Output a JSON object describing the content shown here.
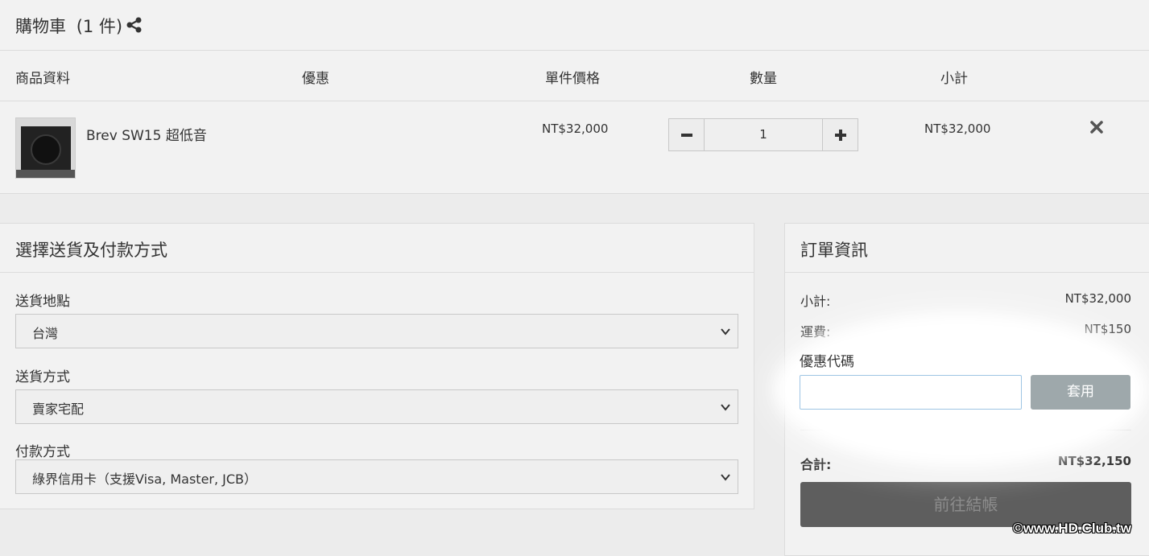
{
  "cart": {
    "title": "購物車",
    "count": "(1 件)",
    "headers": {
      "product": "商品資料",
      "discount": "優惠",
      "unit_price": "單件價格",
      "quantity": "數量",
      "subtotal": "小計"
    },
    "items": [
      {
        "name": "Brev SW15 超低音",
        "unit_price": "NT$32,000",
        "quantity": "1",
        "subtotal": "NT$32,000"
      }
    ]
  },
  "shipping": {
    "title": "選擇送貨及付款方式",
    "location_label": "送貨地點",
    "location_value": "台灣",
    "method_label": "送貨方式",
    "method_value": "賣家宅配",
    "payment_label": "付款方式",
    "payment_value": "綠界信用卡（支援Visa, Master, JCB）"
  },
  "order": {
    "title": "訂單資訊",
    "subtotal_label": "小計:",
    "subtotal_value": "NT$32,000",
    "shipping_label": "運費:",
    "shipping_value": "NT$150",
    "coupon_label": "優惠代碼",
    "coupon_value": "",
    "apply_label": "套用",
    "total_label": "合計:",
    "total_value": "NT$32,150",
    "checkout_label": "前往結帳"
  },
  "watermark": "©www.HD.Club.tw",
  "icons": [
    "share-icon",
    "minus-icon",
    "plus-icon",
    "remove-icon",
    "chevron-down-icon"
  ]
}
